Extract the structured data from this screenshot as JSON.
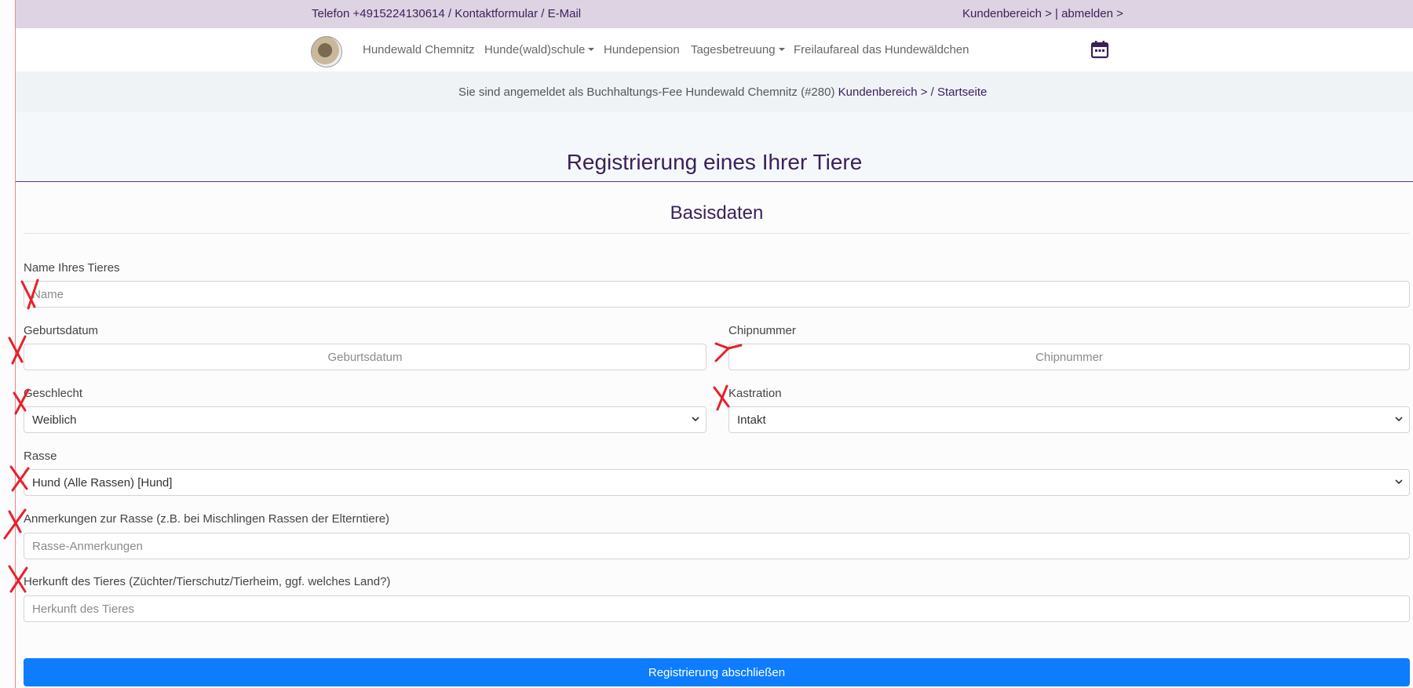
{
  "topbar": {
    "contact": "Telefon +4915224130614 / Kontaktformular / E-Mail",
    "account": "Kundenbereich > | abmelden >"
  },
  "nav": {
    "logo_icon": "dog-logo-icon",
    "items": [
      {
        "label": "Hundewald Chemnitz",
        "dropdown": false
      },
      {
        "label": "Hunde(wald)schule",
        "dropdown": true
      },
      {
        "label": "Hundepension",
        "dropdown": false
      },
      {
        "label": "Tagesbetreuung",
        "dropdown": true
      },
      {
        "label": "Freilaufareal das Hundewäldchen",
        "dropdown": false
      }
    ],
    "calendar_icon": "calendar-icon"
  },
  "login": {
    "prefix": "Sie sind angemeldet als Buchhaltungs-Fee Hundewald Chemnitz (#280)",
    "link": "Kundenbereich >",
    "suffix": "/ Startseite"
  },
  "page": {
    "title": "Registrierung eines Ihrer Tiere",
    "section": "Basisdaten"
  },
  "form": {
    "name": {
      "label": "Name Ihres Tieres",
      "placeholder": "Name",
      "value": ""
    },
    "birth": {
      "label": "Geburtsdatum",
      "placeholder": "Geburtsdatum",
      "value": ""
    },
    "chip": {
      "label": "Chipnummer",
      "placeholder": "Chipnummer",
      "value": ""
    },
    "gender": {
      "label": "Geschlecht",
      "value": "Weiblich"
    },
    "castration": {
      "label": "Kastration",
      "value": "Intakt"
    },
    "breed": {
      "label": "Rasse",
      "value": "Hund (Alle Rassen) [Hund]"
    },
    "breed_notes": {
      "label": "Anmerkungen zur Rasse (z.B. bei Mischlingen Rassen der Elterntiere)",
      "placeholder": "Rasse-Anmerkungen",
      "value": ""
    },
    "origin": {
      "label": "Herkunft des Tieres (Züchter/Tierschutz/Tierheim, ggf. welches Land?)",
      "placeholder": "Herkunft des Tieres",
      "value": ""
    },
    "submit": "Registrierung abschließen"
  },
  "colors": {
    "accent": "#3a1f5a",
    "topbar": "#ded3e2",
    "button": "#0d7cff",
    "annotation": "#e8202a"
  }
}
